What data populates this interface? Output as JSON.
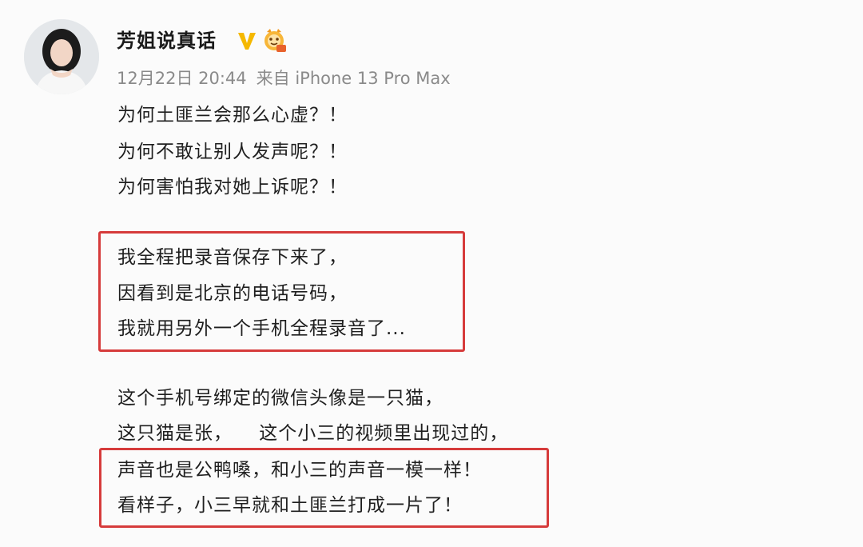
{
  "post": {
    "username": "芳姐说真话",
    "timestamp": "12月22日 20:44",
    "source": "来自 iPhone 13 Pro Max",
    "icons": {
      "avatar": "avatar-icon",
      "verified": "v-verified-icon",
      "member_badge": "member-badge-icon"
    },
    "lines": [
      "为何土匪兰会那么心虚？！",
      "为何不敢让别人发声呢？！",
      "为何害怕我对她上诉呢？！",
      "我全程把录音保存下来了，",
      "因看到是北京的电话号码，",
      "我就用另外一个手机全程录音了...",
      "这个手机号绑定的微信头像是一只猫，",
      "这只猫是张，    这个小三的视频里出现过的，",
      "声音也是公鸭嗓，和小三的声音一模一样！",
      "看样子，小三早就和土匪兰打成一片了！"
    ]
  },
  "colors": {
    "highlight_border": "#d63b3b",
    "meta_text": "#8a8a8a",
    "body_text": "#1f1f1f",
    "verified_gold": "#f5b800"
  }
}
